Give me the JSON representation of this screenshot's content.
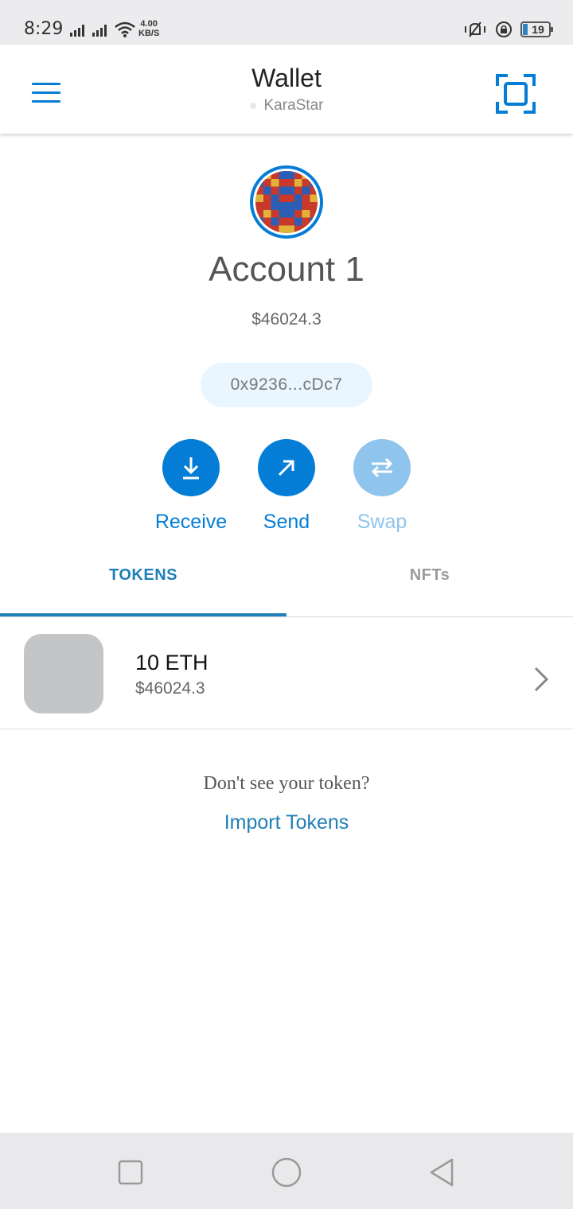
{
  "status_bar": {
    "time": "8:29",
    "net_speed_value": "4.00",
    "net_speed_unit": "KB/S",
    "battery": "19",
    "accent": "#2e86c1"
  },
  "header": {
    "title": "Wallet",
    "network": "KaraStar",
    "menu_icon": "hamburger-menu-icon",
    "scan_icon": "qr-scan-icon"
  },
  "account": {
    "name": "Account 1",
    "balance": "$46024.3",
    "address": "0x9236...cDc7"
  },
  "actions": [
    {
      "label": "Receive",
      "icon": "download-arrow-icon",
      "enabled": true
    },
    {
      "label": "Send",
      "icon": "diagonal-arrow-icon",
      "enabled": true
    },
    {
      "label": "Swap",
      "icon": "swap-arrows-icon",
      "enabled": false
    }
  ],
  "tabs": [
    {
      "label": "TOKENS",
      "active": true
    },
    {
      "label": "NFTs",
      "active": false
    }
  ],
  "tokens": [
    {
      "amount": "10 ETH",
      "fiat": "$46024.3"
    }
  ],
  "import": {
    "prompt": "Don't see your token?",
    "link": "Import Tokens"
  },
  "colors": {
    "primary": "#037dd6",
    "tab_active": "#1f7fb7",
    "disabled": "#8fc4ec",
    "address_bg": "#eaf6ff"
  }
}
